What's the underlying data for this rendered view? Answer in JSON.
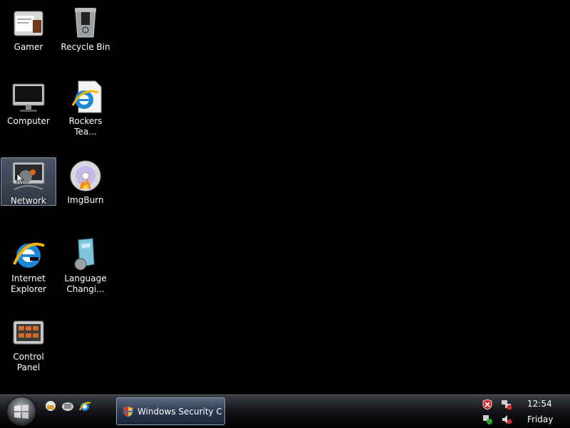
{
  "desktop": {
    "icons": [
      {
        "label": "Gamer"
      },
      {
        "label": "Recycle Bin"
      },
      {
        "label": "Computer"
      },
      {
        "label": "Rockers Tea..."
      },
      {
        "label": "Network"
      },
      {
        "label": "ImgBurn"
      },
      {
        "label": "Internet Explorer"
      },
      {
        "label": "Language Changi..."
      },
      {
        "label": "Control Panel"
      }
    ]
  },
  "taskbar": {
    "quick_launch": [
      "show-desktop-icon",
      "switch-windows-icon",
      "internet-explorer-icon"
    ],
    "active_window_label": "Windows Security C...",
    "clock": {
      "time": "12:54",
      "day": "Friday"
    }
  },
  "colors": {
    "accent": "#2c3a50",
    "selection": "#4a5566"
  }
}
